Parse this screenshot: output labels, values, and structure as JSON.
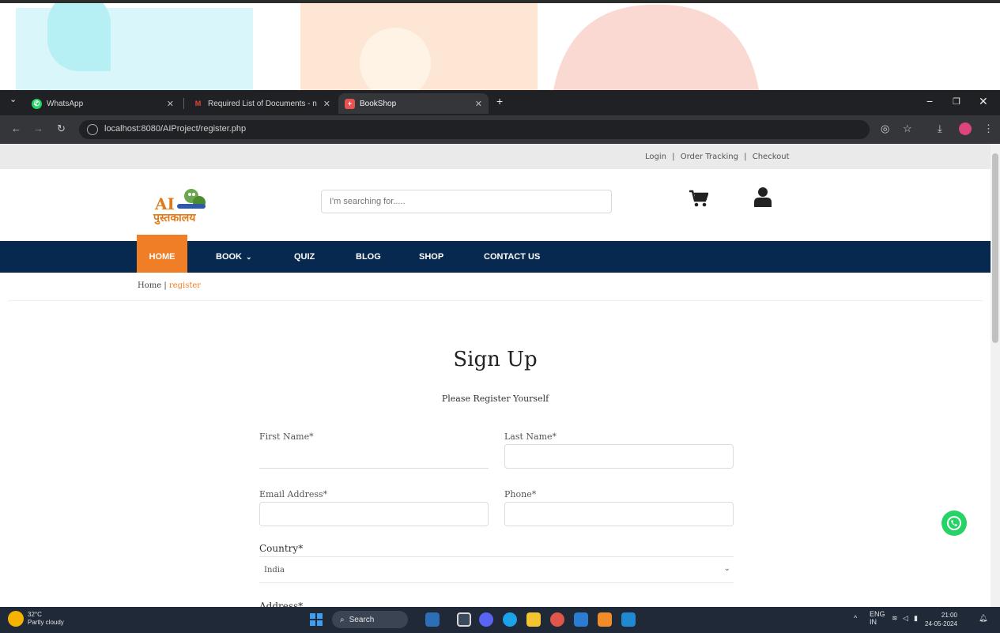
{
  "browser": {
    "tabs": [
      {
        "title": "WhatsApp",
        "active": false
      },
      {
        "title": "Required List of Documents - n",
        "active": false
      },
      {
        "title": "BookShop",
        "active": true
      }
    ],
    "new_tab": "+",
    "url": "localhost:8080/AIProject/register.php"
  },
  "site": {
    "top_links": [
      "Login",
      "|",
      "Order Tracking",
      "|",
      "Checkout"
    ],
    "logo_text": "AI",
    "logo_hindi": "पुस्तकालय",
    "search_placeholder": "I'm searching for.....",
    "menu": [
      {
        "label": "HOME",
        "active": true
      },
      {
        "label": "BOOK",
        "active": false,
        "has_dropdown": true
      },
      {
        "label": "QUIZ",
        "active": false
      },
      {
        "label": "BLOG",
        "active": false
      },
      {
        "label": "SHOP",
        "active": false
      },
      {
        "label": "CONTACT US",
        "active": false
      }
    ],
    "breadcrumb": {
      "home": "Home",
      "separator": "|",
      "current": "register"
    },
    "title": "Sign Up",
    "subtitle": "Please Register Yourself",
    "form": {
      "first_name_label": "First Name*",
      "last_name_label": "Last Name*",
      "email_label": "Email Address*",
      "phone_label": "Phone*",
      "country_label": "Country*",
      "country_value": "India",
      "address_label": "Address*"
    },
    "colors": {
      "accent": "#f07e26",
      "navbar": "#07284f"
    }
  },
  "taskbar": {
    "weather_temp": "32°C",
    "weather_desc": "Partly cloudy",
    "search_label": "Search",
    "lang": "ENG",
    "lang_sub": "IN",
    "time": "21:00",
    "date": "24-05-2024"
  }
}
